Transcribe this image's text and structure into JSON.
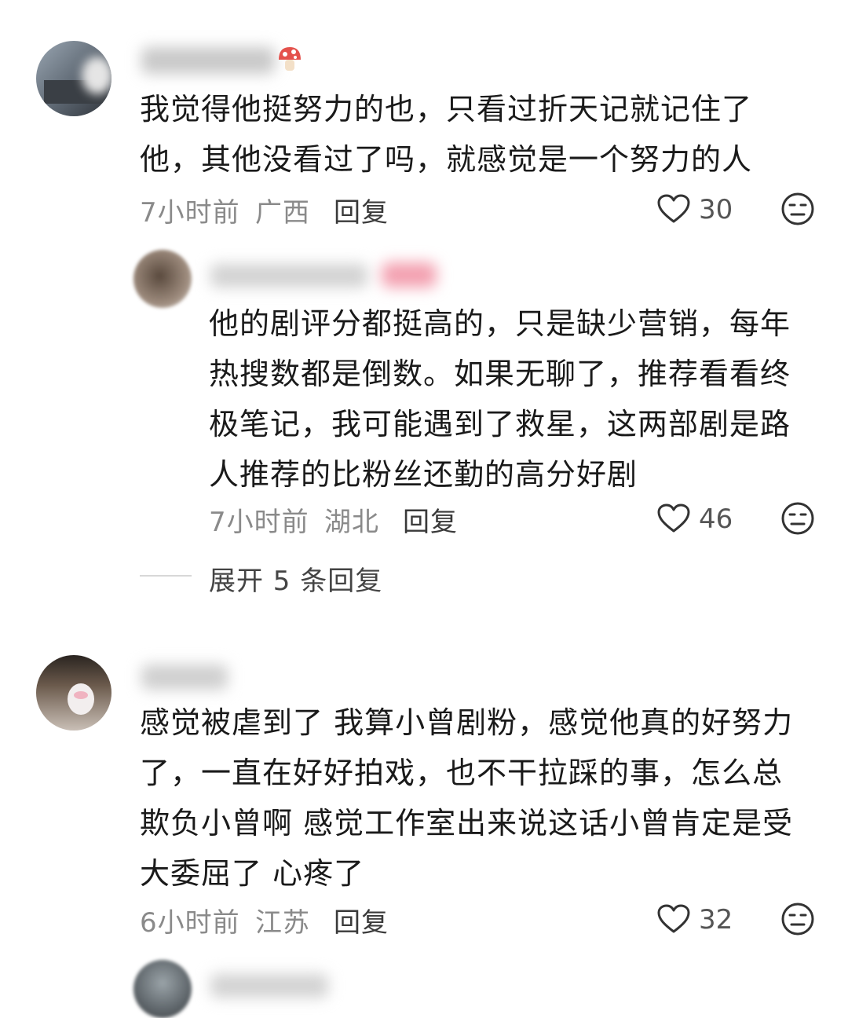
{
  "comments": [
    {
      "text": "我觉得他挺努力的也，只看过折天记就记住了他，其他没看过了吗，就感觉是一个努力的人",
      "time": "7小时前",
      "location": "广西",
      "reply_label": "回复",
      "likes": "30",
      "reply": {
        "text": "他的剧评分都挺高的，只是缺少营销，每年热搜数都是倒数。如果无聊了，推荐看看终极笔记，我可能遇到了救星，这两部剧是路人推荐的比粉丝还勤的高分好剧",
        "time": "7小时前",
        "location": "湖北",
        "reply_label": "回复",
        "likes": "46"
      },
      "expand_label": "展开 5 条回复"
    },
    {
      "text": "感觉被虐到了 我算小曾剧粉，感觉他真的好努力了，一直在好好拍戏，也不干拉踩的事，怎么总欺负小曾啊 感觉工作室出来说这话小曾肯定是受大委屈了 心疼了",
      "time": "6小时前",
      "location": "江苏",
      "reply_label": "回复",
      "likes": "32"
    }
  ],
  "icons": {
    "like": "heart-outline-icon",
    "dislike": "meh-face-icon"
  }
}
